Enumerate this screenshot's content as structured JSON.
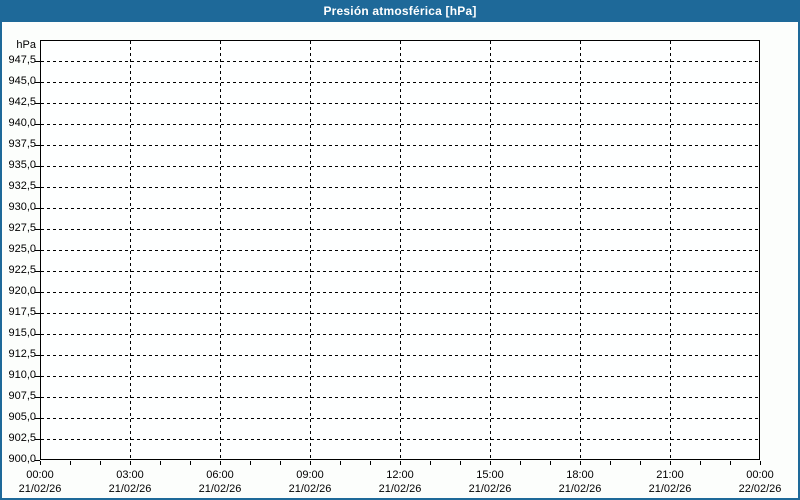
{
  "window": {
    "title": "Presión atmosférica [hPa]"
  },
  "colors": {
    "frame": "#1e6999",
    "title_text": "#ffffff",
    "axis": "#000000",
    "gridline": "#000000",
    "label": "#000000",
    "background": "#fcfefc",
    "plot_background": "#feffff"
  },
  "chart_data": {
    "type": "line",
    "title": "Presión atmosférica [hPa]",
    "xlabel": "",
    "ylabel": "hPa",
    "ylim": [
      900,
      950
    ],
    "y_tick_step": 2.5,
    "y_tick_labels": [
      "900,0",
      "902,5",
      "905,0",
      "907,5",
      "910,0",
      "912,5",
      "915,0",
      "917,5",
      "920,0",
      "922,5",
      "925,0",
      "927,5",
      "930,0",
      "932,5",
      "935,0",
      "937,5",
      "940,0",
      "942,5",
      "945,0",
      "947,5"
    ],
    "x_total_hours": 24,
    "x_major_step_hours": 3,
    "x_minor_step_hours": 1,
    "x_ticks": [
      {
        "time": "00:00",
        "date": "21/02/26"
      },
      {
        "time": "03:00",
        "date": "21/02/26"
      },
      {
        "time": "06:00",
        "date": "21/02/26"
      },
      {
        "time": "09:00",
        "date": "21/02/26"
      },
      {
        "time": "12:00",
        "date": "21/02/26"
      },
      {
        "time": "15:00",
        "date": "21/02/26"
      },
      {
        "time": "18:00",
        "date": "21/02/26"
      },
      {
        "time": "21:00",
        "date": "21/02/26"
      },
      {
        "time": "00:00",
        "date": "22/02/26"
      }
    ],
    "grid": "dashed",
    "legend": "none",
    "series": []
  }
}
